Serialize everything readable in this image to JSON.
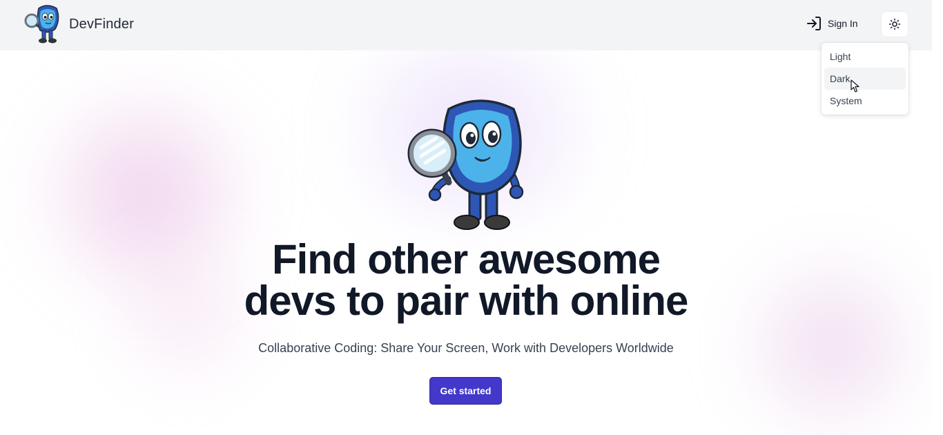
{
  "header": {
    "brand_name": "DevFinder",
    "logo_icon": "mascot-logo-icon",
    "sign_in_label": "Sign In",
    "sign_in_icon": "login-icon",
    "theme_toggle_icon": "sun-icon"
  },
  "theme_menu": {
    "items": [
      {
        "label": "Light",
        "active": false
      },
      {
        "label": "Dark",
        "active": true
      },
      {
        "label": "System",
        "active": false
      }
    ]
  },
  "hero": {
    "mascot_icon": "mascot-magnifier-icon",
    "headline_line1": "Find other awesome",
    "headline_line2": "devs to pair with online",
    "subheadline": "Collaborative Coding: Share Your Screen, Work with Developers Worldwide",
    "cta_label": "Get started"
  },
  "colors": {
    "header_bg": "#f3f4f6",
    "cta_bg": "#4338ca",
    "headline": "#111827",
    "mascot_blue": "#3fa9e6",
    "mascot_dark_blue": "#2d56b5"
  }
}
